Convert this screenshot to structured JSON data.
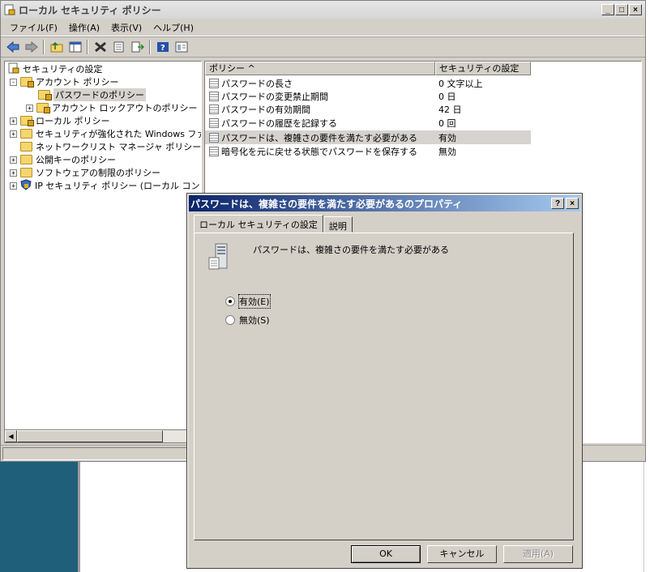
{
  "window": {
    "title": "ローカル セキュリティ ポリシー",
    "min_label": "_",
    "max_label": "□",
    "close_label": "×"
  },
  "menu": [
    "ファイル(F)",
    "操作(A)",
    "表示(V)",
    "ヘルプ(H)"
  ],
  "toolbar_icons": [
    "back-arrow-icon",
    "forward-arrow-icon",
    "up-folder-icon",
    "show-tree-icon",
    "delete-icon",
    "properties-icon",
    "export-icon",
    "help-icon",
    "view-icon"
  ],
  "tree": {
    "root": "セキュリティの設定",
    "items": [
      {
        "label": "アカウント ポリシー",
        "expander": "-"
      },
      {
        "label": "パスワードのポリシー",
        "expander": ""
      },
      {
        "label": "アカウント ロックアウトのポリシー",
        "expander": "+"
      },
      {
        "label": "ローカル ポリシー",
        "expander": "+"
      },
      {
        "label": "セキュリティが強化された Windows ファイア",
        "expander": "+"
      },
      {
        "label": "ネットワークリスト マネージャ ポリシー",
        "expander": ""
      },
      {
        "label": "公開キーのポリシー",
        "expander": "+"
      },
      {
        "label": "ソフトウェアの制限のポリシー",
        "expander": "+"
      },
      {
        "label": "IP セキュリティ ポリシー (ローカル コンピュー",
        "expander": "+"
      }
    ]
  },
  "list": {
    "columns": [
      "ポリシー  ^",
      "セキュリティの設定"
    ],
    "rows": [
      {
        "policy": "パスワードの長さ",
        "value": "0 文字以上"
      },
      {
        "policy": "パスワードの変更禁止期間",
        "value": "0 日"
      },
      {
        "policy": "パスワードの有効期間",
        "value": "42 日"
      },
      {
        "policy": "パスワードの履歴を記録する",
        "value": "0 回"
      },
      {
        "policy": "パスワードは、複雑さの要件を満たす必要がある",
        "value": "有効"
      },
      {
        "policy": "暗号化を元に戻せる状態でパスワードを保存する",
        "value": "無効"
      }
    ]
  },
  "dialog": {
    "title": "パスワードは、複雑さの要件を満たす必要があるのプロパティ",
    "help_label": "?",
    "close_label": "×",
    "tabs": [
      "ローカル セキュリティの設定",
      "説明"
    ],
    "policy_name": "パスワードは、複雑さの要件を満たす必要がある",
    "options": [
      {
        "label": "有効(E)",
        "selected": true
      },
      {
        "label": "無効(S)",
        "selected": false
      }
    ],
    "ok_label": "OK",
    "cancel_label": "キャンセル",
    "apply_label": "適用(A)"
  }
}
